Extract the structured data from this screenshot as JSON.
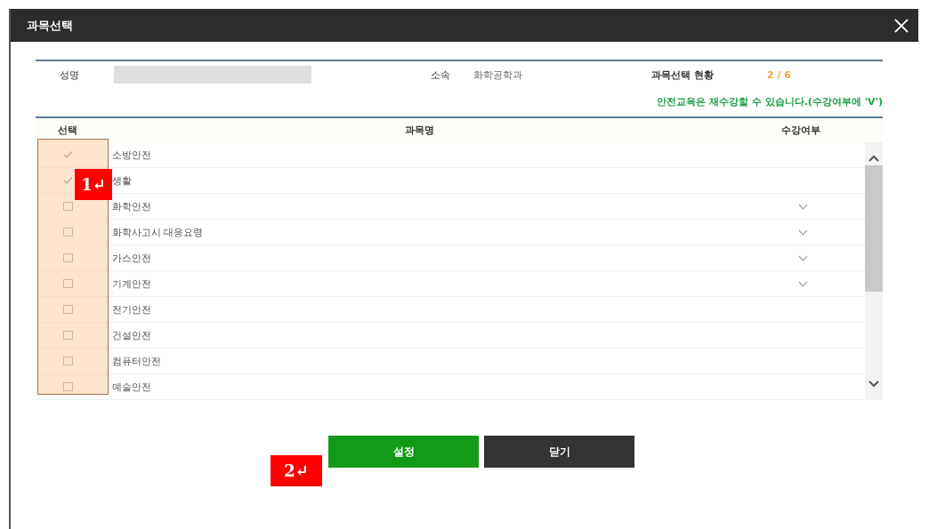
{
  "dialog": {
    "title": "과목선택"
  },
  "info": {
    "name_label": "성명",
    "affiliation_label": "소속",
    "affiliation": "화학공학과",
    "status_label": "과목선택 현황",
    "status": "2 / 6"
  },
  "notice": "안전교육은 재수강할 수 있습니다.(수강여부에 'V')",
  "table": {
    "columns": [
      "선택",
      "과목명",
      "수강여부"
    ],
    "rows": [
      {
        "name": "소방안전",
        "checked": true,
        "taken": false
      },
      {
        "name": "생활",
        "checked": true,
        "taken": false
      },
      {
        "name": "화학안전",
        "checked": false,
        "taken": true
      },
      {
        "name": "화학사고시 대응요령",
        "checked": false,
        "taken": true
      },
      {
        "name": "가스안전",
        "checked": false,
        "taken": true
      },
      {
        "name": "기계안전",
        "checked": false,
        "taken": true
      },
      {
        "name": "전기안전",
        "checked": false,
        "taken": false
      },
      {
        "name": "건설안전",
        "checked": false,
        "taken": false
      },
      {
        "name": "컴퓨터안전",
        "checked": false,
        "taken": false
      },
      {
        "name": "예술안전",
        "checked": false,
        "taken": false
      }
    ]
  },
  "buttons": [
    {
      "label": "설정",
      "kind": "primary"
    },
    {
      "label": "닫기",
      "kind": "secondary"
    }
  ],
  "annotations": [
    {
      "label": "1↵"
    },
    {
      "label": "2↵"
    }
  ]
}
